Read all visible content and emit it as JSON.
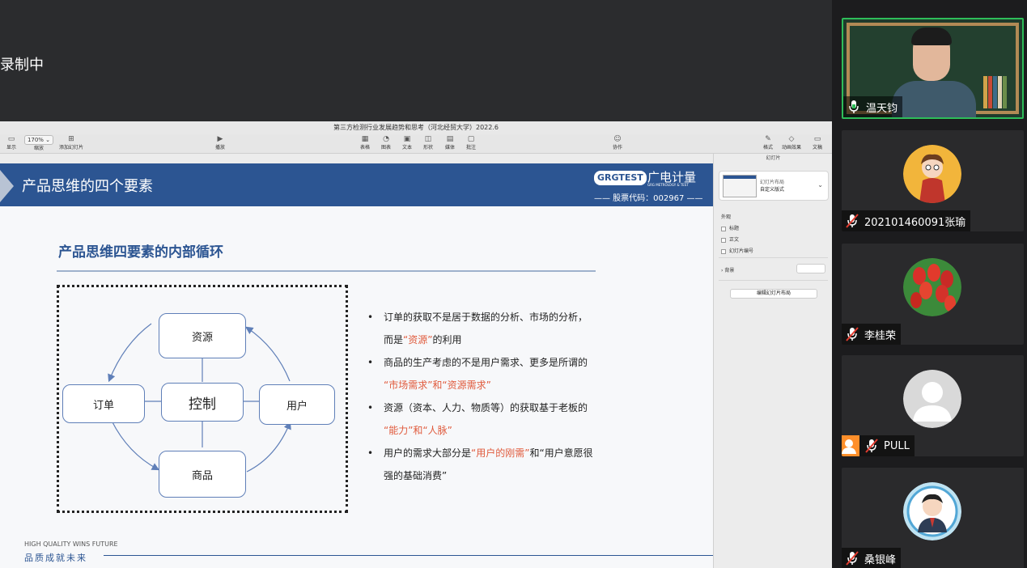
{
  "recording": {
    "status_text": "录制中"
  },
  "keynote": {
    "document_title": "第三方检测行业发展趋势和思考（河北经贸大学）2022.6",
    "toolbar_left": [
      {
        "icon": "sidebar-icon",
        "label": "显示"
      },
      {
        "icon": "zoom-icon",
        "label": "缩放"
      },
      {
        "icon": "add-slide-icon",
        "label": "添加幻灯片"
      }
    ],
    "zoom_value": "170% ⌄",
    "play_label": "播放",
    "toolbar_center": [
      "表格",
      "图表",
      "文本",
      "形状",
      "媒体",
      "批注"
    ],
    "collaborate_label": "协作",
    "toolbar_right": [
      "格式",
      "动画效果",
      "文稿"
    ]
  },
  "inspector": {
    "tab_title": "幻灯片",
    "layout_label": "幻灯片布局",
    "layout_value": "自定义版式",
    "appearance_label": "外观",
    "checkboxes": [
      "标题",
      "正文",
      "幻灯片编号"
    ],
    "background_label": "背景",
    "edit_layout_button": "编辑幻灯片布局"
  },
  "slide": {
    "header_title": "产品思维的四个要素",
    "logo_brand": "GRGTEST",
    "logo_cn": "广电计量",
    "logo_en": "GRG METROLOGY & TEST",
    "stock_code": "—— 股票代码：002967 ——",
    "subtitle": "产品思维四要素的内部循环",
    "diagram": {
      "top": "资源",
      "left": "订单",
      "center": "控制",
      "right": "用户",
      "bottom": "商品"
    },
    "bullets": [
      {
        "line1": "订单的获取不是居于数据的分析、市场的分析，",
        "line2_pre": "而是",
        "line2_hl": "“资源”",
        "line2_post": "的利用"
      },
      {
        "line1": "商品的生产考虑的不是用户需求、更多是所谓的",
        "line2_pre": "",
        "line2_hl": "“市场需求”和“资源需求”",
        "line2_post": ""
      },
      {
        "line1": "资源（资本、人力、物质等）的获取基于老板的",
        "line2_pre": "",
        "line2_hl": "“能力”和“人脉”",
        "line2_post": ""
      },
      {
        "line1_pre": "用户的需求大部分是",
        "line1_hl": "“用户的刚需”",
        "line1_post": "和“用户意愿很",
        "line2_pre": "强的基础消费”",
        "line2_hl": "",
        "line2_post": ""
      }
    ],
    "footer_en": "HIGH QUALITY WINS FUTURE",
    "footer_cn": "品质成就未来"
  },
  "participants": [
    {
      "name": "温天钧",
      "mic": "on",
      "video": true
    },
    {
      "name": "202101460091张瑜",
      "mic": "muted"
    },
    {
      "name": "李桂荣",
      "mic": "muted"
    },
    {
      "name": "PULL",
      "mic": "muted"
    },
    {
      "name": "桑银峰",
      "mic": "muted"
    }
  ],
  "colors": {
    "slide_blue": "#2c5592",
    "highlight_red": "#e05a3c",
    "speaking_green": "#2ebd59"
  }
}
